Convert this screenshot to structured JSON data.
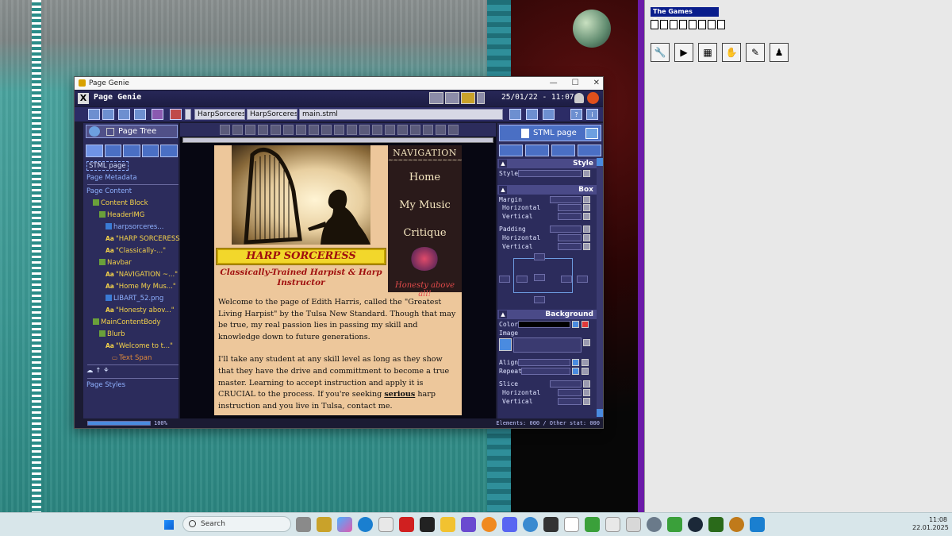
{
  "colors": {
    "desktop_teal": "#3a9792",
    "window_bg": "#1b1b33",
    "accent_blue": "#4a6fc4",
    "page_bg": "#edc79b",
    "banner_yellow": "#f2d72b",
    "heading_red": "#a0100f"
  },
  "background_app": {
    "title": "The Games Factory"
  },
  "window": {
    "title": "Page Genie",
    "controls": {
      "minimize": "—",
      "maximize": "☐",
      "close": "✕"
    },
    "app_name": "Page Genie",
    "clock": "25/01/22 - 11:07a",
    "toolbar": {
      "field1": "HarpSorceress",
      "field2": "HarpSorceress",
      "field3": "main.stml"
    },
    "left_panel": {
      "header": "Page Tree",
      "tree": [
        {
          "label": "STML page",
          "depth": 0,
          "kind": "page"
        },
        {
          "label": "Page Metadata",
          "depth": 0,
          "kind": "meta"
        },
        {
          "label": "Page Content",
          "depth": 0,
          "kind": "root"
        },
        {
          "label": "Content Block",
          "depth": 1,
          "kind": "block"
        },
        {
          "label": "HeaderIMG",
          "depth": 2,
          "kind": "block"
        },
        {
          "label": "harpsorceres...",
          "depth": 3,
          "kind": "img"
        },
        {
          "label": "\"HARP SORCERESS\"",
          "depth": 3,
          "kind": "text"
        },
        {
          "label": "\"Classically-...\"",
          "depth": 3,
          "kind": "text"
        },
        {
          "label": "Navbar",
          "depth": 2,
          "kind": "block"
        },
        {
          "label": "\"NAVIGATION ~...\"",
          "depth": 3,
          "kind": "text"
        },
        {
          "label": "\"Home  My Mus...\"",
          "depth": 3,
          "kind": "text"
        },
        {
          "label": "LIBART_52.png",
          "depth": 3,
          "kind": "img"
        },
        {
          "label": "\"Honesty abov...\"",
          "depth": 3,
          "kind": "text"
        },
        {
          "label": "MainContentBody",
          "depth": 1,
          "kind": "block"
        },
        {
          "label": "Blurb",
          "depth": 2,
          "kind": "block"
        },
        {
          "label": "\"Welcome to t...\"",
          "depth": 3,
          "kind": "text"
        },
        {
          "label": "Text Span",
          "depth": 4,
          "kind": "span"
        }
      ],
      "styles": "Page Styles"
    },
    "page": {
      "title": "HARP SORCERESS",
      "subtitle": "Classically-Trained Harpist & Harp Instructor",
      "nav": {
        "heading": "NAVIGATION",
        "tilde": "~~~~~~~~~~~~~~~~~",
        "links": [
          "Home",
          "My Music",
          "Critique"
        ],
        "footer": "Honesty above all!"
      },
      "body": {
        "p1": "Welcome to the page of Edith Harris, called the \"Greatest Living Harpist\" by the Tulsa New Standard. Though that may be true, my real passion lies in passing my skill and knowledge down to future generations.",
        "p2a": "I'll take any student at any skill level as long as they show that they have the drive and committment to become a true master. Learning to accept instruction and apply it is CRUCIAL to the process. If you're seeking ",
        "p2b": "serious",
        "p2c": " harp instruction and you live in Tulsa, contact me."
      }
    },
    "right_panel": {
      "header": "STML page",
      "style": {
        "title": "Style",
        "label": "Style"
      },
      "box": {
        "title": "Box",
        "margin": "Margin",
        "horizontal": "Horizontal",
        "vertical": "Vertical",
        "padding": "Padding"
      },
      "background": {
        "title": "Background",
        "color": "Color",
        "image": "Image",
        "align": "Align",
        "repeat": "Repeat",
        "slice": "Slice",
        "horizontal": "Horizontal",
        "vertical": "Vertical"
      }
    },
    "status": {
      "progress_pct": 100,
      "progress_label": "100%",
      "right": "Elements: 000 / Other stat: 000"
    }
  },
  "taskbar": {
    "search": "Search",
    "time": "11:08",
    "date": "22.01.2025"
  }
}
